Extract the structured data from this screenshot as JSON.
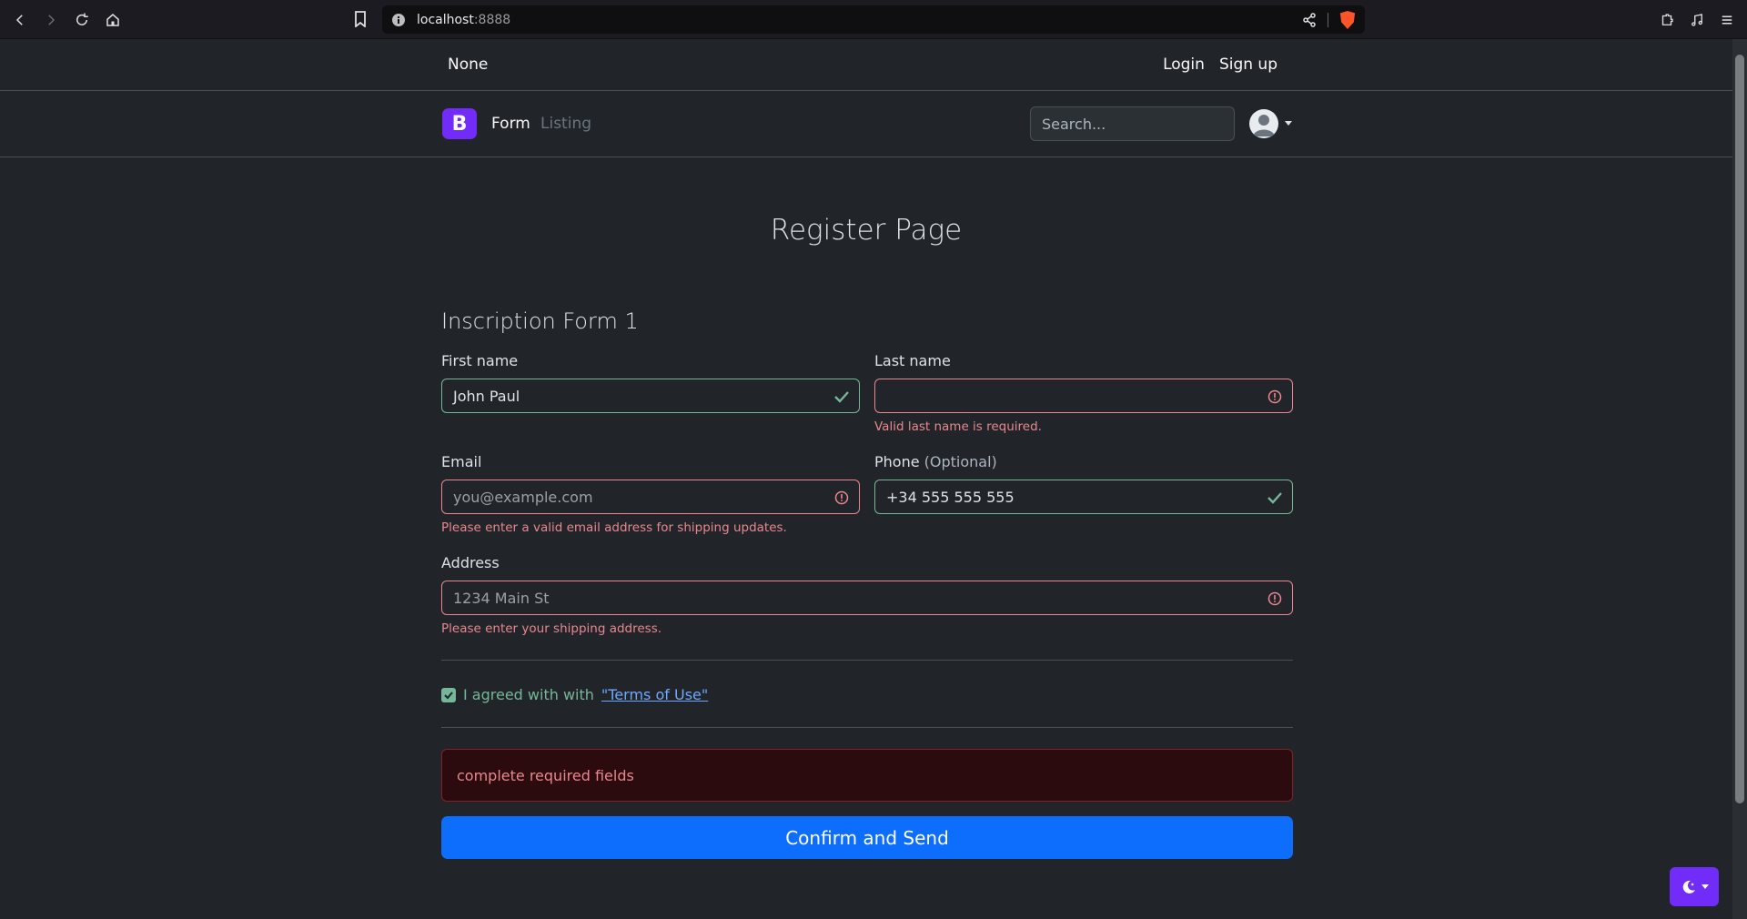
{
  "browser": {
    "url_host": "localhost",
    "url_port": ":8888"
  },
  "topbar": {
    "brand": "None",
    "login": "Login",
    "signup": "Sign up"
  },
  "navbar": {
    "logo_letter": "B",
    "nav_form": "Form",
    "nav_listing": "Listing",
    "search_placeholder": "Search..."
  },
  "page": {
    "title": "Register Page",
    "form_title": "Inscription Form 1"
  },
  "form": {
    "first_name": {
      "label": "First name",
      "value": "John Paul",
      "state": "valid"
    },
    "last_name": {
      "label": "Last name",
      "value": "",
      "state": "invalid",
      "feedback": "Valid last name is required."
    },
    "email": {
      "label": "Email",
      "placeholder": "you@example.com",
      "state": "invalid",
      "feedback": "Please enter a valid email address for shipping updates."
    },
    "phone": {
      "label": "Phone",
      "optional": "(Optional)",
      "value": "+34 555 555 555",
      "state": "valid"
    },
    "address": {
      "label": "Address",
      "placeholder": "1234 Main St",
      "state": "invalid",
      "feedback": "Please enter your shipping address."
    },
    "terms": {
      "checked": true,
      "label": "I agreed with with",
      "link": "\"Terms of Use\""
    },
    "alert": "complete required fields",
    "submit": "Confirm and Send"
  },
  "colors": {
    "valid": "#75b798",
    "invalid": "#ea868f",
    "primary": "#0d6efd",
    "brand": "#712cf9"
  }
}
